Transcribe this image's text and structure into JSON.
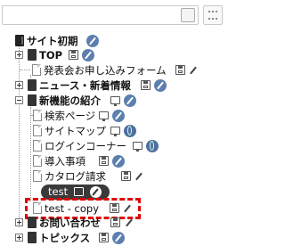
{
  "search": {
    "value": "",
    "placeholder": ""
  },
  "tree": {
    "root": {
      "label": "サイト初期"
    },
    "items": {
      "top": {
        "label": "TOP"
      },
      "apply_form": {
        "label": "発表会お申し込みフォーム"
      },
      "news": {
        "label": "ニュース・新着情報"
      },
      "new_features": {
        "label": "新機能の紹介"
      },
      "search_page": {
        "label": "検索ページ"
      },
      "sitemap": {
        "label": "サイトマップ"
      },
      "login_corner": {
        "label": "ログインコーナー"
      },
      "intro_cases": {
        "label": "導入事項"
      },
      "catalog_request": {
        "label": "カタログ請求"
      },
      "test_drag": {
        "label": "test"
      },
      "test_copy": {
        "label": "test - copy"
      },
      "contact": {
        "label": "お問い合わせ"
      },
      "topics": {
        "label": "トピックス"
      }
    }
  },
  "colors": {
    "highlight": "#e00000",
    "edit_icon": "#5c7fb0",
    "drag_pill": "#3a3a3a"
  },
  "icons": [
    "filter-icon",
    "grid-view-icon",
    "folder-book-icon",
    "page-icon",
    "save-icon",
    "monitor-icon",
    "edit-pencil-icon",
    "globe-icon"
  ]
}
